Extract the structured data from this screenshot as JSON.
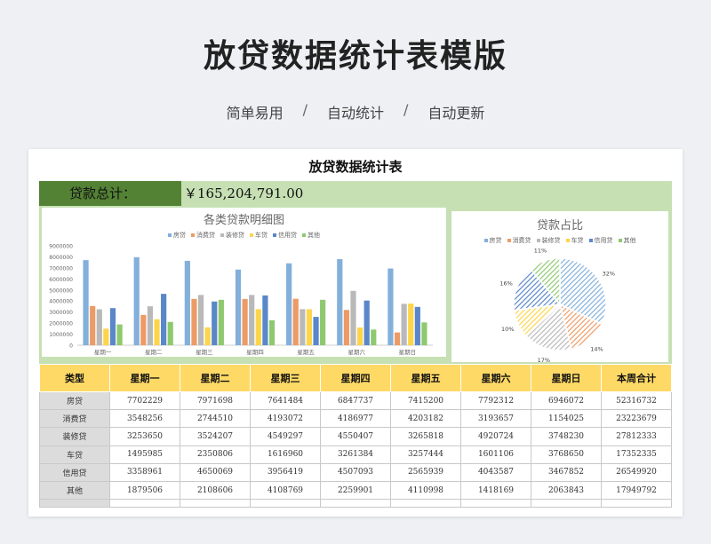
{
  "page": {
    "title": "放贷数据统计表模版",
    "features": [
      "简单易用",
      "自动统计",
      "自动更新"
    ],
    "separator": "/"
  },
  "sheet": {
    "title": "放贷数据统计表",
    "total_label": "贷款总计：",
    "total_value": "￥165,204,791.00"
  },
  "colors": {
    "房贷": "#82b0db",
    "消费贷": "#ed9b66",
    "装修贷": "#b9b9b9",
    "车贷": "#fdd54a",
    "信用贷": "#5a87c8",
    "其他": "#8ec96f"
  },
  "chart_data": [
    {
      "type": "bar",
      "title": "各类贷款明细图",
      "categories": [
        "星期一",
        "星期二",
        "星期三",
        "星期四",
        "星期五",
        "星期六",
        "星期日"
      ],
      "ylim": [
        0,
        9000000
      ],
      "yticks": [
        "0",
        "1000000",
        "2000000",
        "3000000",
        "4000000",
        "5000000",
        "6000000",
        "7000000",
        "8000000",
        "9000000"
      ],
      "legend_position": "top",
      "series": [
        {
          "name": "房贷",
          "values": [
            7702229,
            7971698,
            7641484,
            6847737,
            7415200,
            7792312,
            6946072
          ]
        },
        {
          "name": "消费贷",
          "values": [
            3548256,
            2744510,
            4193072,
            4186977,
            4203182,
            3193657,
            1154025
          ]
        },
        {
          "name": "装修贷",
          "values": [
            3253650,
            3524207,
            4549297,
            4550407,
            3265818,
            4920724,
            3748230
          ]
        },
        {
          "name": "车贷",
          "values": [
            1495985,
            2350806,
            1616960,
            3261384,
            3257444,
            1601106,
            3768650
          ]
        },
        {
          "name": "信用贷",
          "values": [
            3358961,
            4650069,
            3956419,
            4507093,
            2565939,
            4043587,
            3467852
          ]
        },
        {
          "name": "其他",
          "values": [
            1879506,
            2108606,
            4108769,
            2259901,
            4110998,
            1418169,
            2063843
          ]
        }
      ]
    },
    {
      "type": "pie",
      "title": "贷款占比",
      "legend_position": "top",
      "categories": [
        "房贷",
        "消费贷",
        "装修贷",
        "车贷",
        "信用贷",
        "其他"
      ],
      "values": [
        32,
        14,
        17,
        10,
        16,
        11
      ],
      "labels": [
        "32%",
        "14%",
        "17%",
        "10%",
        "16%",
        "11%"
      ]
    }
  ],
  "table": {
    "headers": [
      "类型",
      "星期一",
      "星期二",
      "星期三",
      "星期四",
      "星期五",
      "星期六",
      "星期日",
      "本周合计"
    ],
    "rows": [
      [
        "房贷",
        "7702229",
        "7971698",
        "7641484",
        "6847737",
        "7415200",
        "7792312",
        "6946072",
        "52316732"
      ],
      [
        "消费贷",
        "3548256",
        "2744510",
        "4193072",
        "4186977",
        "4203182",
        "3193657",
        "1154025",
        "23223679"
      ],
      [
        "装修贷",
        "3253650",
        "3524207",
        "4549297",
        "4550407",
        "3265818",
        "4920724",
        "3748230",
        "27812333"
      ],
      [
        "车贷",
        "1495985",
        "2350806",
        "1616960",
        "3261384",
        "3257444",
        "1601106",
        "3768650",
        "17352335"
      ],
      [
        "信用贷",
        "3358961",
        "4650069",
        "3956419",
        "4507093",
        "2565939",
        "4043587",
        "3467852",
        "26549920"
      ],
      [
        "其他",
        "1879506",
        "2108606",
        "4108769",
        "2259901",
        "4110998",
        "1418169",
        "2063843",
        "17949792"
      ]
    ]
  }
}
